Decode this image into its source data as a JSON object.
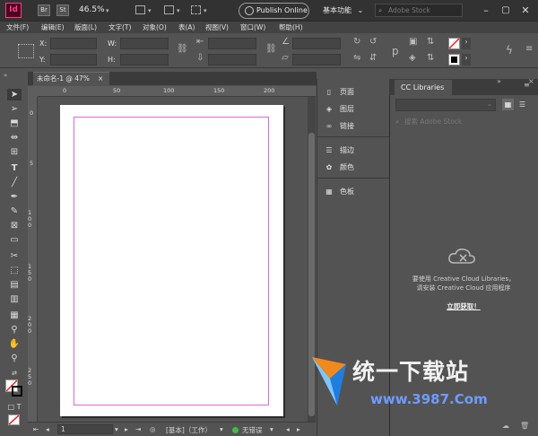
{
  "appbar": {
    "logo": "Id",
    "bridge": "Br",
    "stock": "St",
    "zoom": "46.5%",
    "publish_label": "Publish Online",
    "workspace": "基本功能",
    "search_placeholder": "Adobe Stock"
  },
  "menu": [
    "文件(F)",
    "编辑(E)",
    "版面(L)",
    "文字(T)",
    "对象(O)",
    "表(A)",
    "视图(V)",
    "窗口(W)",
    "帮助(H)"
  ],
  "control": {
    "x_label": "X:",
    "y_label": "Y:",
    "w_label": "W:",
    "h_label": "H:"
  },
  "document": {
    "tab_title": "未命名-1 @ 47%",
    "tab_close": "×",
    "hruler_ticks": [
      "0",
      "50",
      "100",
      "150",
      "200"
    ],
    "vruler_ticks": [
      "0",
      "5",
      "100",
      "150",
      "200",
      "250"
    ]
  },
  "status": {
    "page_number": "1",
    "style": "[基本]（工作）",
    "errors": "无错误"
  },
  "panels": {
    "group1": [
      "页面",
      "图层",
      "链接"
    ],
    "group2": [
      "描边",
      "颜色"
    ],
    "group3": [
      "色板"
    ]
  },
  "libraries": {
    "tab": "CC Libraries",
    "search_placeholder": "搜索 Adobe Stock",
    "message_line1": "要使用 Creative Cloud Libraries，",
    "message_line2": "请安装 Creative Cloud 应用程序",
    "link": "立即获取！"
  },
  "watermark": {
    "text": "统一下载站",
    "url": "www.3987.Com"
  },
  "colors": {
    "indesign_accent": "#ff3d8b",
    "margin_guide": "#d86ad8",
    "status_ok": "#3fbf3f"
  }
}
